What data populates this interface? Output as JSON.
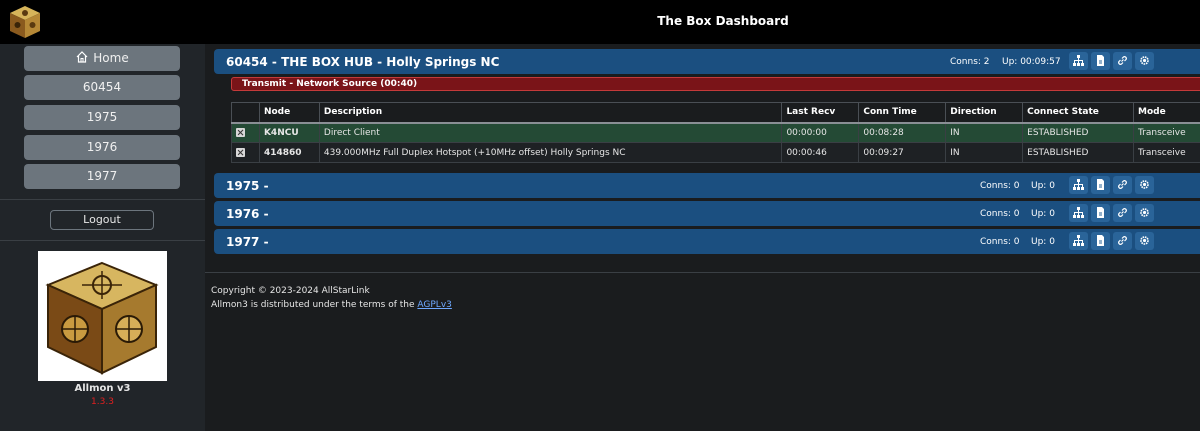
{
  "header": {
    "title": "The Box Dashboard"
  },
  "sidebar": {
    "items": [
      {
        "label": "Home",
        "icon": "home-icon"
      },
      {
        "label": "60454"
      },
      {
        "label": "1975"
      },
      {
        "label": "1976"
      },
      {
        "label": "1977"
      }
    ],
    "logout_label": "Logout",
    "app_name": "Allmon v3",
    "app_version": "1.3.3"
  },
  "nodes": [
    {
      "title": "60454 - THE BOX HUB - Holly Springs NC",
      "conns": "Conns: 2",
      "uptime": "Up: 00:09:57"
    },
    {
      "title": "1975 -",
      "conns": "Conns: 0",
      "uptime": "Up: 0"
    },
    {
      "title": "1976 -",
      "conns": "Conns: 0",
      "uptime": "Up: 0"
    },
    {
      "title": "1977 -",
      "conns": "Conns: 0",
      "uptime": "Up: 0"
    }
  ],
  "node_buttons": [
    "sitemap-icon",
    "file-icon",
    "link-icon",
    "gear-icon"
  ],
  "transmit": {
    "label": "Transmit - Network Source (00:40)"
  },
  "table": {
    "headers": [
      "Node",
      "Description",
      "Last Recv",
      "Conn Time",
      "Direction",
      "Connect State",
      "Mode"
    ],
    "rows": [
      {
        "node": "K4NCU",
        "description": "Direct Client",
        "last_recv": "00:00:00",
        "conn_time": "00:08:28",
        "direction": "IN",
        "state": "ESTABLISHED",
        "mode": "Transceive"
      },
      {
        "node": "414860",
        "description": "439.000MHz Full Duplex Hotspot (+10MHz offset) Holly Springs NC",
        "last_recv": "00:00:46",
        "conn_time": "00:09:27",
        "direction": "IN",
        "state": "ESTABLISHED",
        "mode": "Transceive"
      }
    ]
  },
  "footer": {
    "copyright": "Copyright © 2023-2024 AllStarLink",
    "license_prefix": "Allmon3 is distributed under the terms of the ",
    "license_link": "AGPLv3"
  },
  "colors": {
    "node_bar": "#1b4f80",
    "transmit": "#7a1418",
    "active_row": "#244a35",
    "version": "#e02020"
  }
}
